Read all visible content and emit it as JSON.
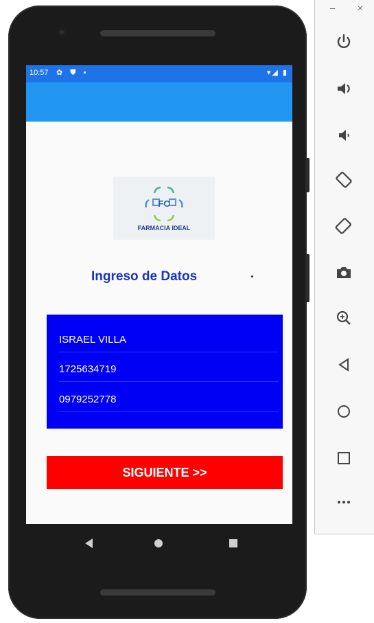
{
  "status_bar": {
    "time": "10:57",
    "left_icons": "✿ ⛊ ▪",
    "right_icons": "▾◢ ▮"
  },
  "logo": {
    "text": "FARMACIA IDEAL",
    "letters": "FC"
  },
  "form": {
    "heading": "Ingreso de Datos",
    "fields": [
      {
        "value": "ISRAEL VILLA"
      },
      {
        "value": "1725634719"
      },
      {
        "value": "0979252778"
      }
    ],
    "next_button": "SIGUIENTE >>"
  },
  "window_controls": {
    "minimize": "–",
    "close": "×"
  },
  "emulator_toolbar": {
    "buttons": [
      "power-icon",
      "volume-up-icon",
      "volume-down-icon",
      "rotate-left-icon",
      "rotate-right-icon",
      "camera-icon",
      "zoom-icon",
      "back-icon",
      "home-icon",
      "overview-icon",
      "more-icon"
    ]
  },
  "colors": {
    "appbar": "#2196f3",
    "statusbar": "#1e73e8",
    "panel": "#0000f5",
    "button": "#ff0000",
    "heading": "#1a33c4"
  }
}
